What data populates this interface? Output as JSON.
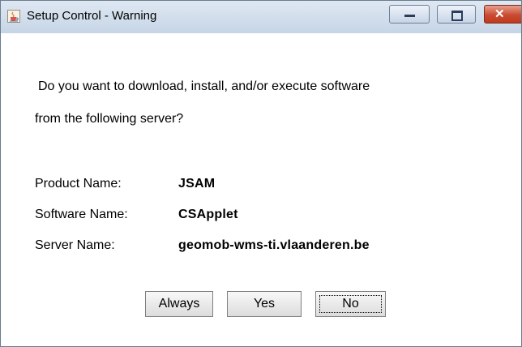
{
  "window": {
    "title": "Setup Control - Warning",
    "icon": "java-cup-icon",
    "controls": {
      "minimize": "minimize-icon",
      "maximize": "maximize-icon",
      "close": "close-icon",
      "close_glyph": "✕"
    }
  },
  "message": {
    "line1": "Do you want to download, install, and/or execute software",
    "line2": "from the following server?"
  },
  "details": [
    {
      "label": "Product Name:",
      "value": "JSAM"
    },
    {
      "label": "Software Name:",
      "value": "CSApplet"
    },
    {
      "label": "Server Name:",
      "value": "geomob-wms-ti.vlaanderen.be"
    }
  ],
  "buttons": {
    "always": "Always",
    "yes": "Yes",
    "no": "No"
  },
  "colors": {
    "titlebar": "#c6d5e6",
    "close_button": "#c94b32"
  }
}
